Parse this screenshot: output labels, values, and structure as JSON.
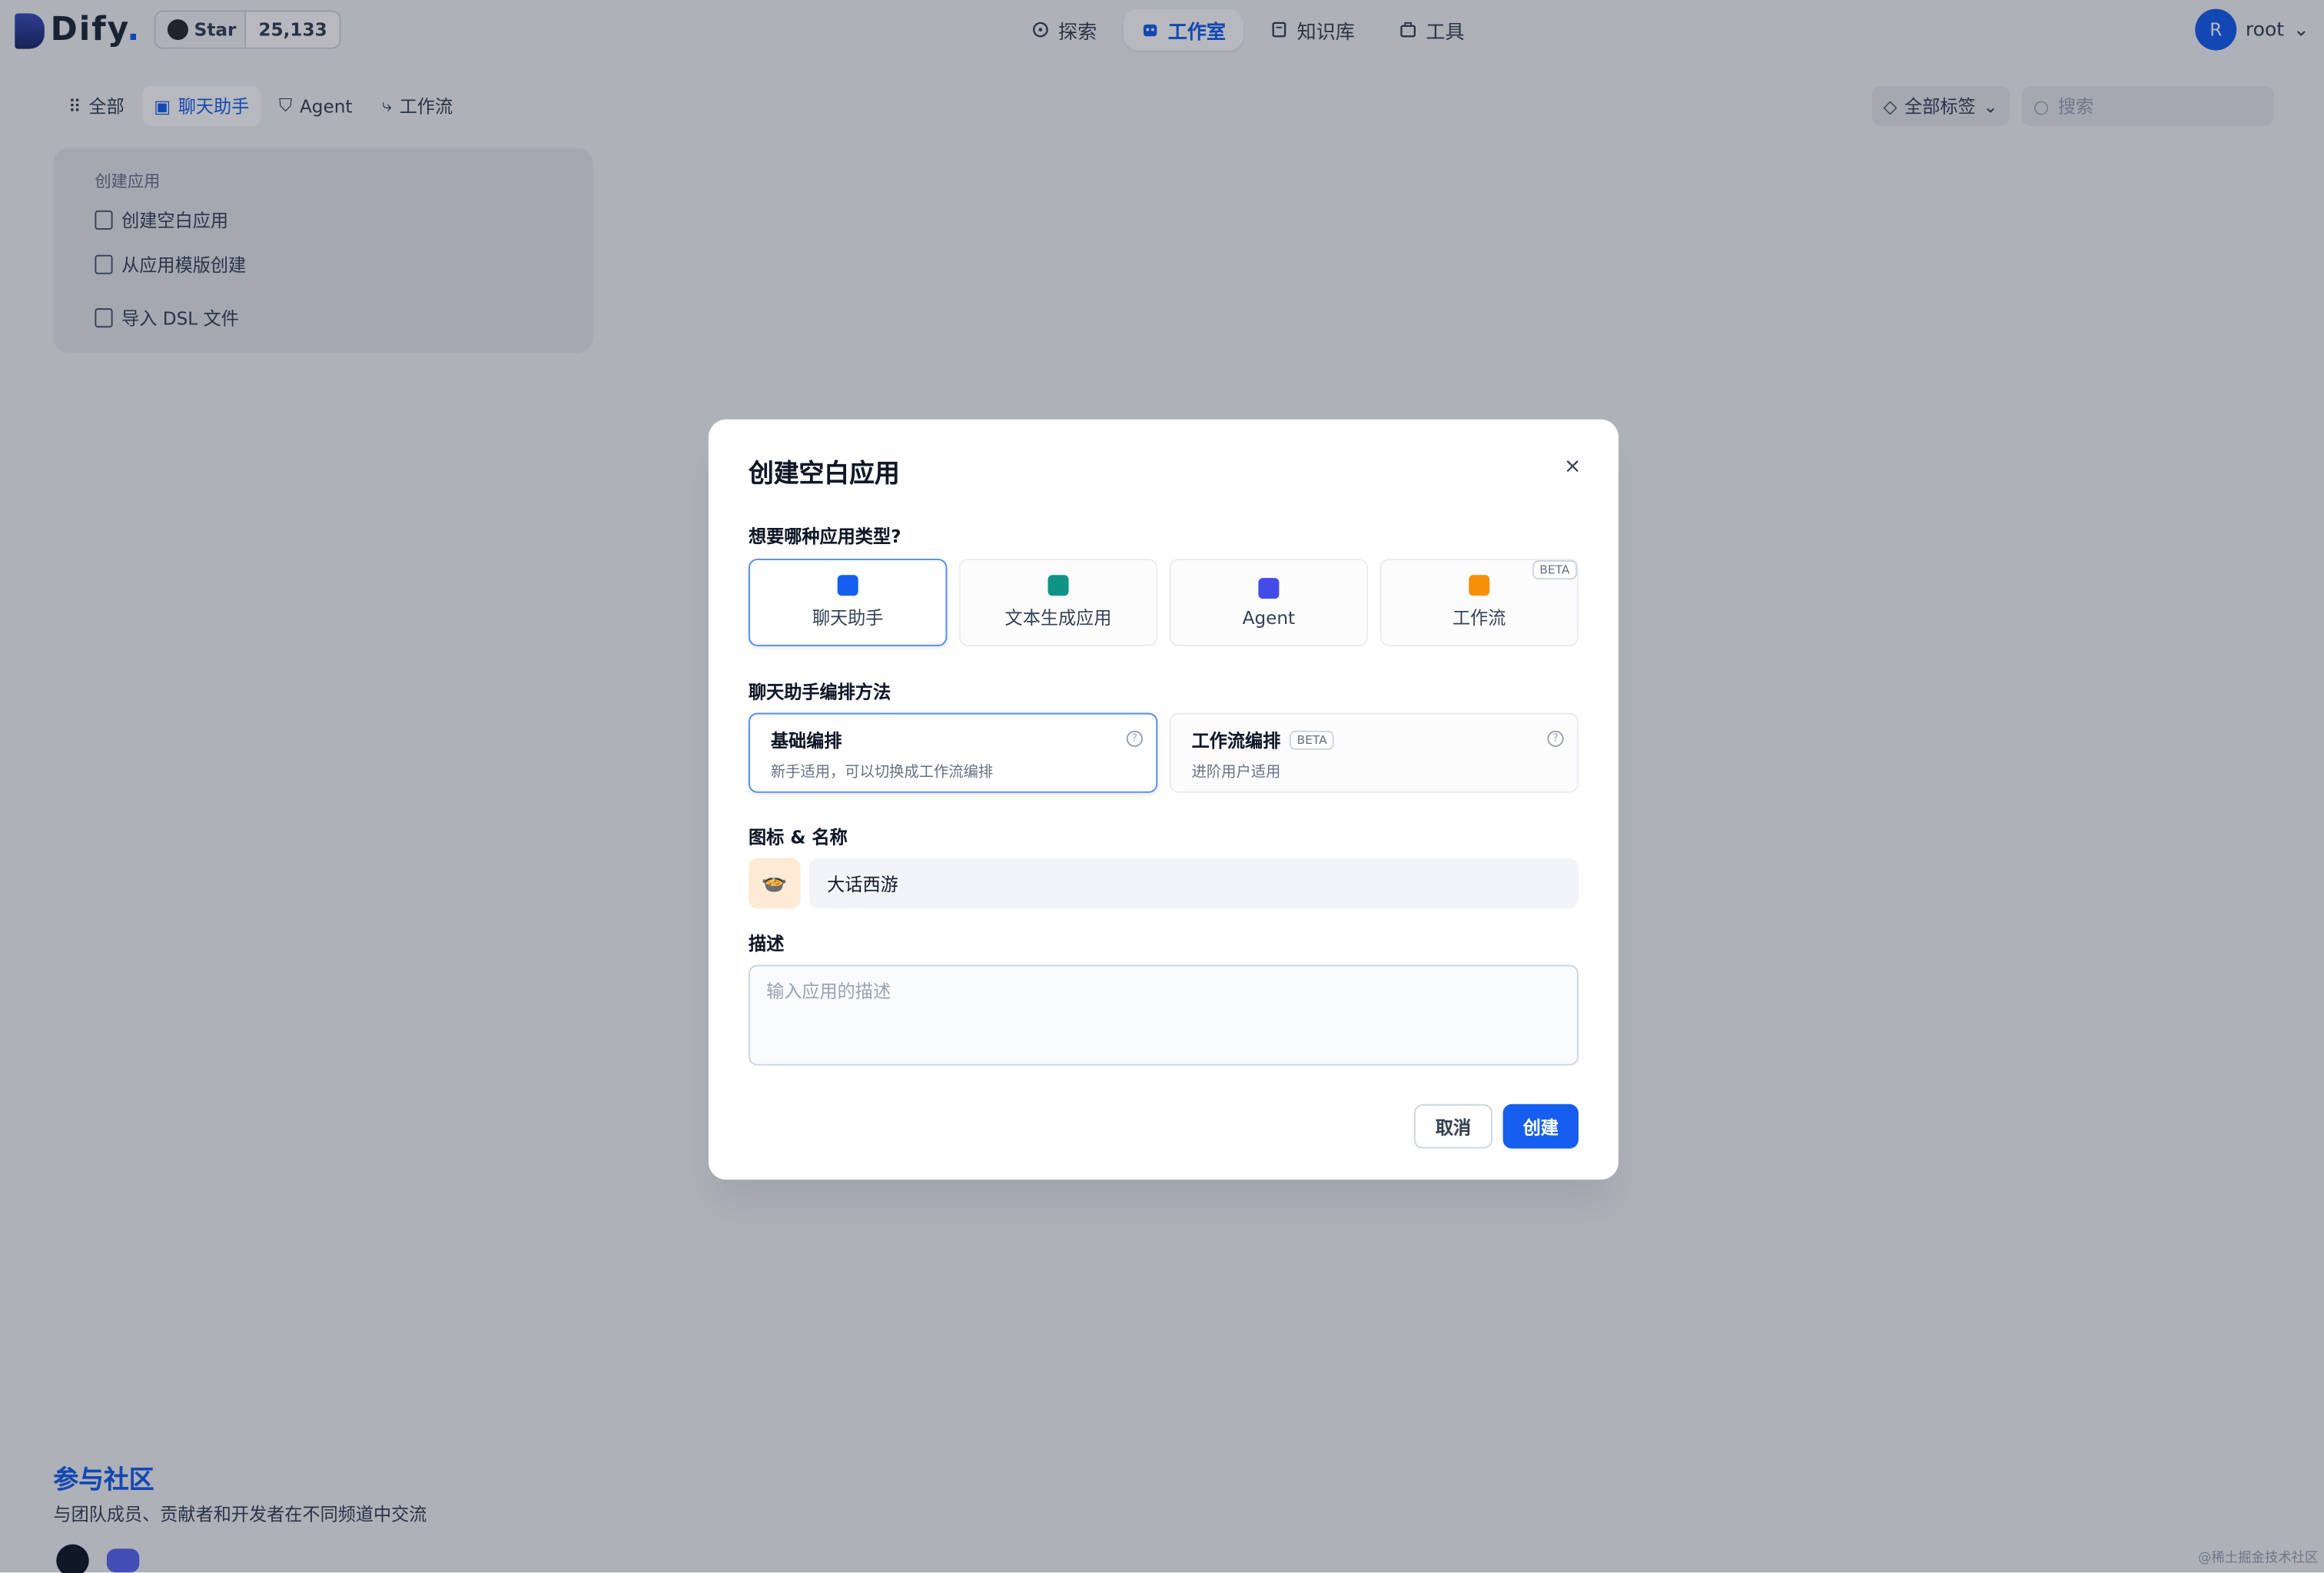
{
  "brand": {
    "name": "Dify",
    "dot": "."
  },
  "github": {
    "star_label": "Star",
    "count": "25,133"
  },
  "nav": [
    {
      "label": "探索",
      "icon": "compass-icon"
    },
    {
      "label": "工作室",
      "icon": "robot-icon"
    },
    {
      "label": "知识库",
      "icon": "book-icon"
    },
    {
      "label": "工具",
      "icon": "briefcase-icon"
    }
  ],
  "user": {
    "initial": "R",
    "name": "root"
  },
  "tabs": [
    {
      "label": "全部"
    },
    {
      "label": "聊天助手"
    },
    {
      "label": "Agent"
    },
    {
      "label": "工作流"
    }
  ],
  "filters": {
    "tags_label": "全部标签",
    "search_placeholder": "搜索"
  },
  "create_card": {
    "title": "创建应用",
    "items": [
      "创建空白应用",
      "从应用模版创建",
      "导入 DSL 文件"
    ]
  },
  "community": {
    "title": "参与社区",
    "subtitle": "与团队成员、贡献者和开发者在不同频道中交流"
  },
  "watermark": "@稀土掘金技术社区",
  "modal": {
    "title": "创建空白应用",
    "close": "×",
    "type_question": "想要哪种应用类型?",
    "types": [
      {
        "label": "聊天助手",
        "color": "#155eef"
      },
      {
        "label": "文本生成应用",
        "color": "#0e9384"
      },
      {
        "label": "Agent",
        "color": "#444ce7"
      },
      {
        "label": "工作流",
        "color": "#f79009",
        "beta": "BETA"
      }
    ],
    "mode_label": "聊天助手编排方法",
    "modes": [
      {
        "title": "基础编排",
        "subtitle": "新手适用，可以切换成工作流编排"
      },
      {
        "title": "工作流编排",
        "badge": "BETA",
        "subtitle": "进阶用户适用"
      }
    ],
    "name_label": "图标 & 名称",
    "app_icon": "🍲",
    "app_name": "大话西游",
    "desc_label": "描述",
    "desc_placeholder": "输入应用的描述",
    "cancel": "取消",
    "create": "创建"
  }
}
